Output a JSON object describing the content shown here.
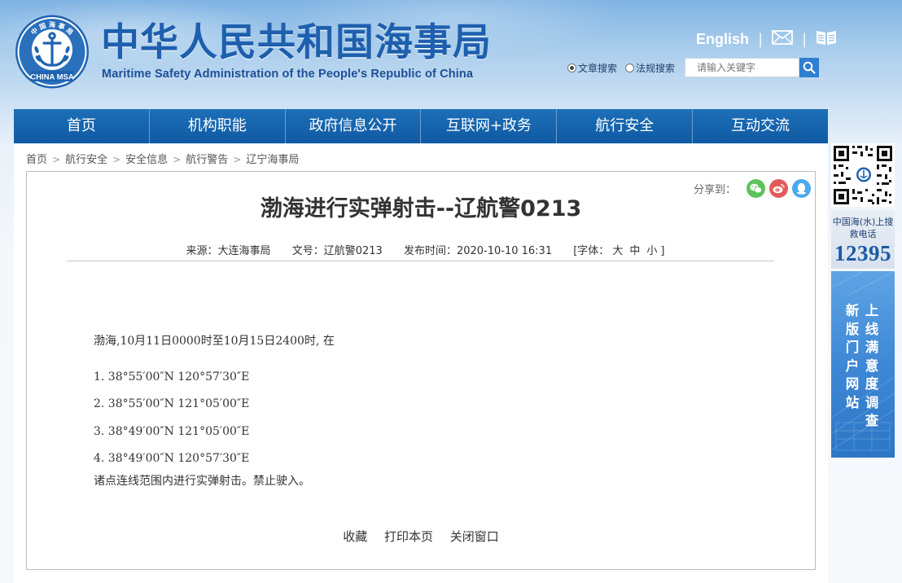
{
  "header": {
    "title_cn": "中华人民共和国海事局",
    "title_en": "Maritime Safety Administration of the People's Republic of China",
    "logo": {
      "top_text": "中 国 海 事 局",
      "bottom_text": "CHINA MSA"
    },
    "english_link": "English",
    "separator": "|",
    "mail_icon": "mail-icon",
    "book_icon": "book-icon"
  },
  "search": {
    "options": [
      "文章搜索",
      "法规搜索"
    ],
    "selected_index": 0,
    "placeholder": "请输入关键字",
    "button_icon": "search-icon"
  },
  "nav": {
    "items": [
      "首页",
      "机构职能",
      "政府信息公开",
      "互联网+政务",
      "航行安全",
      "互动交流"
    ]
  },
  "breadcrumb": {
    "items": [
      "首页",
      "航行安全",
      "安全信息",
      "航行警告",
      "辽宁海事局"
    ],
    "separator": ">"
  },
  "share": {
    "label": "分享到：",
    "buttons": [
      {
        "name": "wechat-icon",
        "color": "#5ec25a"
      },
      {
        "name": "weibo-icon",
        "color": "#e35a5a"
      },
      {
        "name": "qq-icon",
        "color": "#4ba9ec"
      }
    ]
  },
  "article": {
    "title": "渤海进行实弹射击--辽航警0213",
    "meta": {
      "source": "来源：大连海事局",
      "doc_no": "文号：辽航警0213",
      "publish_time": "发布时间：2020-10-10 16:31",
      "font_size_label": "[字体：",
      "font_sizes": [
        "大",
        "中",
        "小"
      ],
      "font_size_close": "]"
    },
    "body": [
      "渤海,10月11日0000时至10月15日2400时, 在",
      "1. 38°55′00″N  120°57′30″E",
      "2. 38°55′00″N  121°05′00″E",
      "3. 38°49′00″N  121°05′00″E",
      "4. 38°49′00″N  120°57′30″E",
      "诸点连线范围内进行实弹射击。禁止驶入。"
    ],
    "footer_links": [
      "收藏",
      "打印本页",
      "关闭窗口"
    ]
  },
  "sidebar": {
    "qr_icon": "qr-code-icon",
    "hotline_label": "中国海(水)上搜救电话",
    "hotline_number": "12395",
    "survey_col1": "新版门户网站",
    "survey_col2": "上线满意度调查"
  },
  "colors": {
    "brand_blue": "#1e5fae",
    "nav_blue": "#1563ab",
    "survey_blue": "#3e88d6"
  }
}
